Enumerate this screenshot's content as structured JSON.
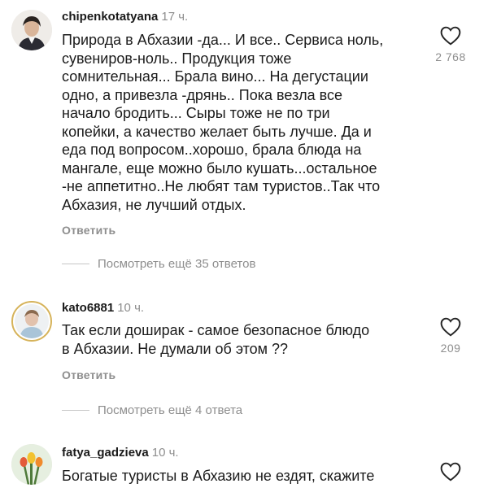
{
  "comments": [
    {
      "username": "chipenkotatyana",
      "time": "17 ч.",
      "text_lines": [
        "Природа в Абхазии -да... И все.. Сервиса ноль,",
        "сувениров-ноль.. Продукция тоже",
        "сомнительная... Брала вино... На дегустации",
        "одно, а привезла -дрянь.. Пока везла все",
        "начало бродить... Сыры тоже не по три",
        "копейки, а качество желает быть лучше. Да и",
        "еда под вопросом..хорошо, брала блюда на",
        "мангале, еще можно было кушать...остальное",
        "-не аппетитно..Не любят там туристов..Так что",
        "Абхазия, не лучший отдых."
      ],
      "reply_label": "Ответить",
      "view_replies": "Посмотреть ещё 35 ответов",
      "like_count": "2 768",
      "like_icon": "heart-outline-icon"
    },
    {
      "username": "kato6881",
      "time": "10 ч.",
      "text_lines": [
        "Так если доширак - самое безопасное блюдо",
        "в Абхазии. Не думали об этом ??"
      ],
      "reply_label": "Ответить",
      "view_replies": "Посмотреть ещё 4 ответа",
      "like_count": "209",
      "like_icon": "heart-outline-icon"
    },
    {
      "username": "fatya_gadzieva",
      "time": "10 ч.",
      "text_lines": [
        "Богатые туристы в Абхазию не ездят, скажите"
      ],
      "like_icon": "heart-outline-icon"
    }
  ],
  "colors": {
    "text": "#1b1b1b",
    "muted": "#8e8e8e",
    "story_ring": "#d6b35a"
  }
}
